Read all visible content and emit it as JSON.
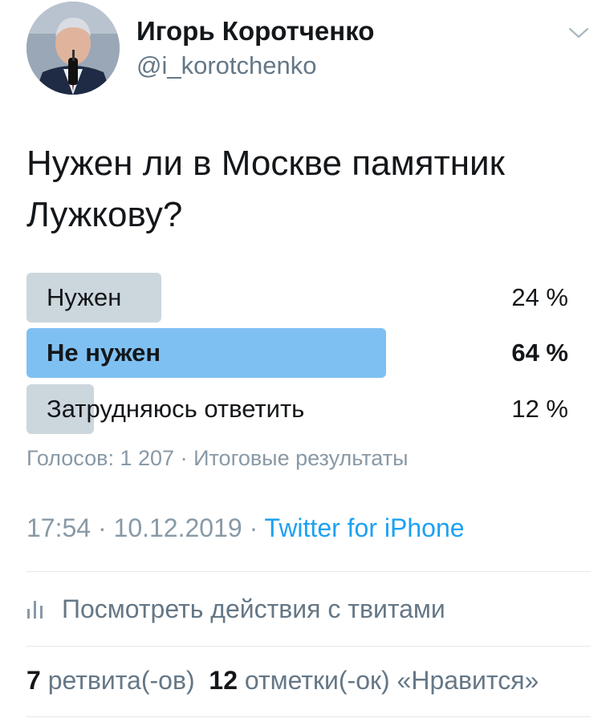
{
  "author": {
    "name": "Игорь Коротченко",
    "handle": "@i_korotchenko"
  },
  "tweet": {
    "text": "Нужен ли в Москве памятник Лужкову?"
  },
  "poll": {
    "options": [
      {
        "label": "Нужен",
        "percent_label": "24 %",
        "percent": 24,
        "winner": false
      },
      {
        "label": "Не нужен",
        "percent_label": "64 %",
        "percent": 64,
        "winner": true
      },
      {
        "label": "Затрудняюсь ответить",
        "percent_label": "12 %",
        "percent": 12,
        "winner": false
      }
    ],
    "votes_text": "Голосов: 1 207",
    "separator": "·",
    "status_text": "Итоговые результаты"
  },
  "meta": {
    "time": "17:54",
    "separator": "·",
    "date": "10.12.2019",
    "source": "Twitter for iPhone"
  },
  "activity": {
    "label": "Посмотреть действия с твитами"
  },
  "stats": {
    "retweets_count": "7",
    "retweets_label": "ретвита(-ов)",
    "likes_count": "12",
    "likes_label": "отметки(-ок) «Нравится»"
  },
  "colors": {
    "winner_bar": "#7fc0f2",
    "bar": "#ccd6dd",
    "link": "#1da1f2",
    "secondary_text": "#8899a6"
  },
  "icons": [
    "chevron-down-icon",
    "bar-chart-icon"
  ]
}
